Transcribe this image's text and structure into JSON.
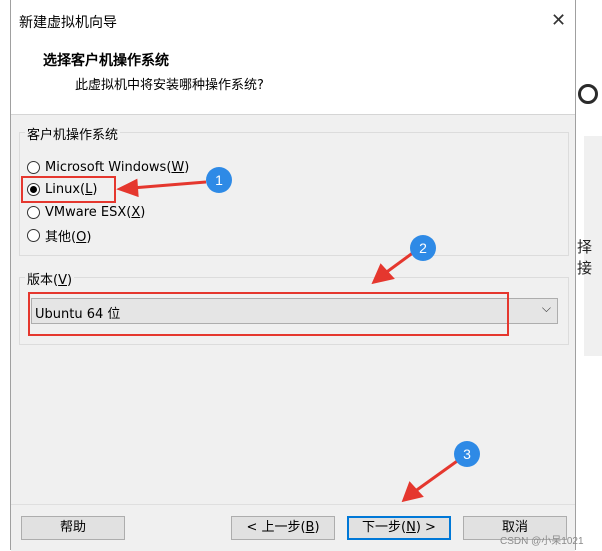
{
  "background": {
    "partial_text": "择接"
  },
  "window": {
    "title": "新建虚拟机向导",
    "close_symbol": "✕"
  },
  "header": {
    "title": "选择客户机操作系统",
    "subtitle": "此虚拟机中将安装哪种操作系统?"
  },
  "guest_os": {
    "label": "客户机操作系统",
    "options": [
      {
        "pre": "Microsoft Windows(",
        "key": "W",
        "post": ")",
        "checked": false
      },
      {
        "pre": "Linux(",
        "key": "L",
        "post": ")",
        "checked": true
      },
      {
        "pre": "VMware ESX(",
        "key": "X",
        "post": ")",
        "checked": false
      },
      {
        "pre": "其他(",
        "key": "O",
        "post": ")",
        "checked": false
      }
    ]
  },
  "version": {
    "label_pre": "版本(",
    "label_key": "V",
    "label_post": ")",
    "selected": "Ubuntu 64 位",
    "arrow": "⌵"
  },
  "annotations": {
    "badges": [
      "1",
      "2",
      "3"
    ],
    "accent": "#e5372e",
    "badge_color": "#2e8ae6"
  },
  "buttons": {
    "help": "帮助",
    "back_pre": "< 上一步(",
    "back_key": "B",
    "back_post": ")",
    "next_pre": "下一步(",
    "next_key": "N",
    "next_post": ") >",
    "cancel": "取消"
  },
  "watermark": "CSDN @小呆1021"
}
